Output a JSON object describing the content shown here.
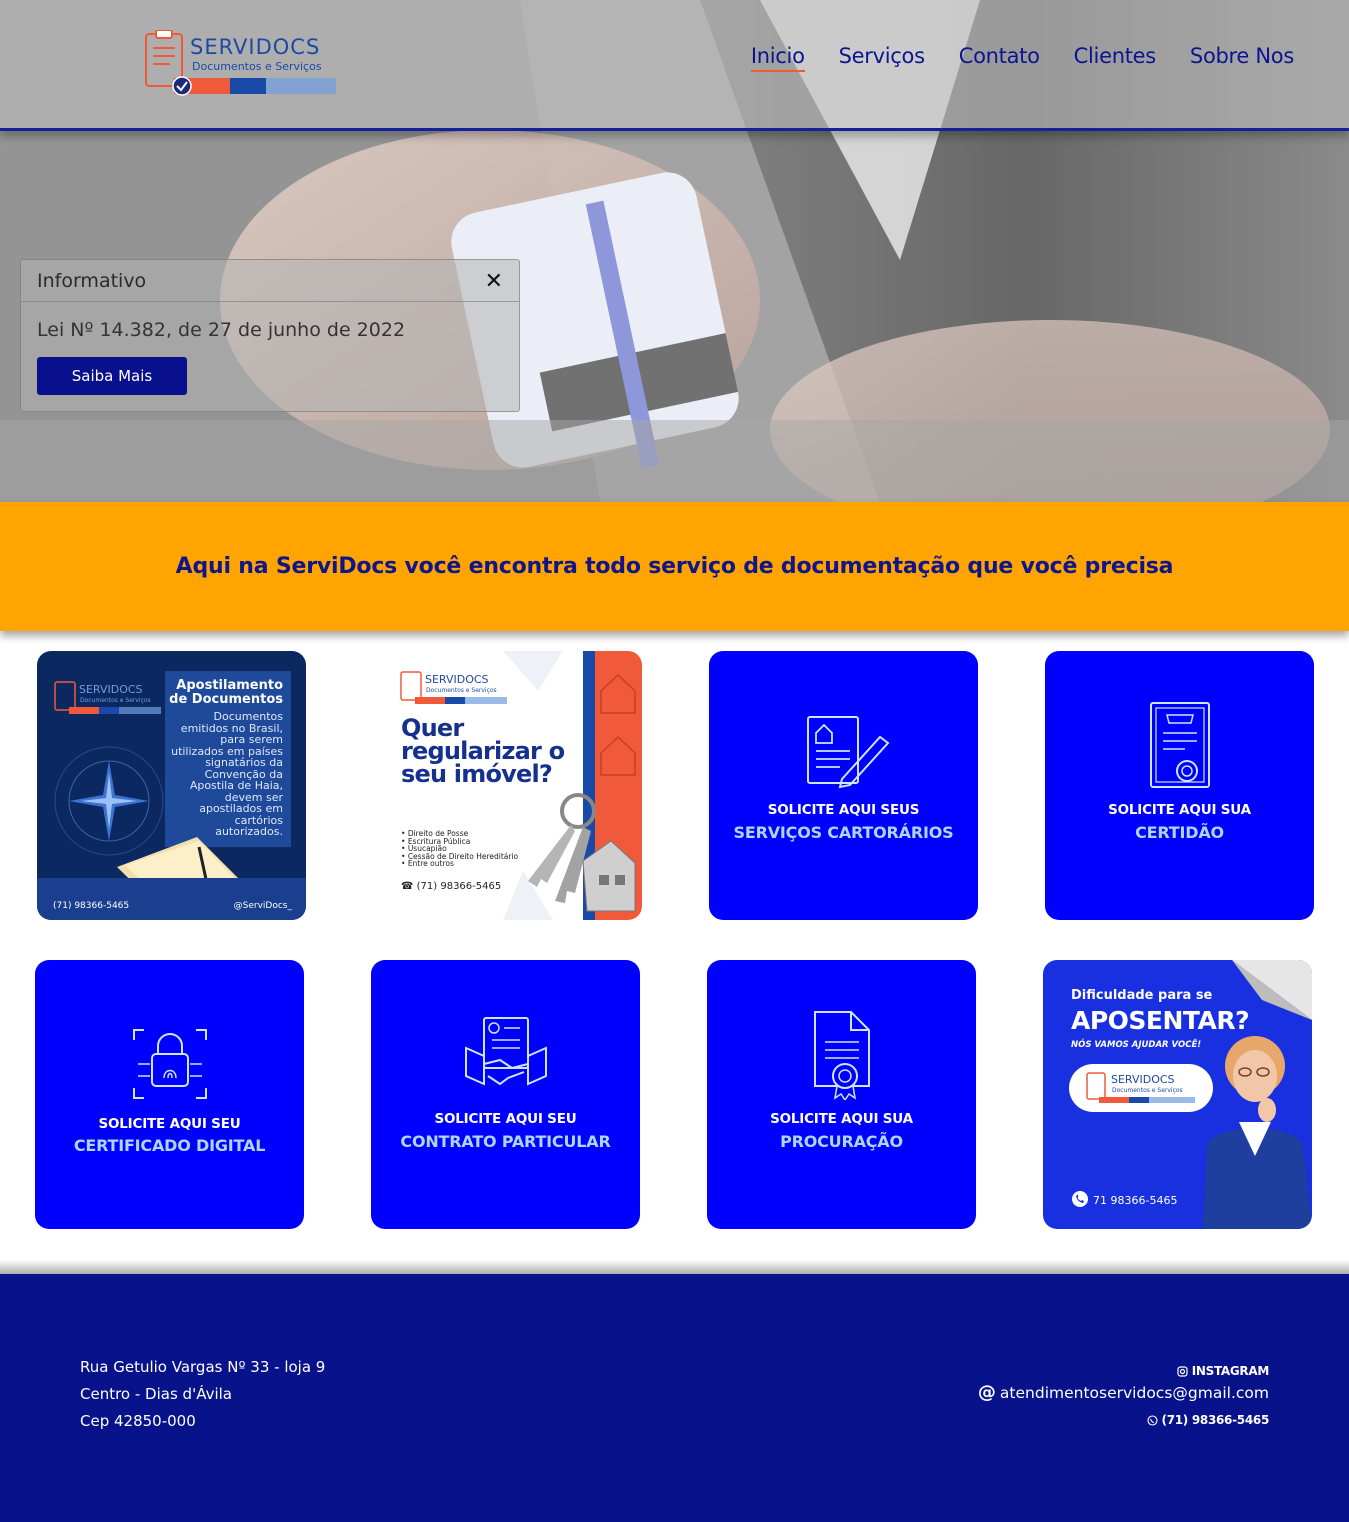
{
  "brand": {
    "name": "SERVIDOCS",
    "tagline": "Documentos e Serviços",
    "colors": {
      "navy": "#08128b",
      "blue": "#0000ff",
      "orange": "#ffa400",
      "coral": "#f05a3a"
    }
  },
  "nav": {
    "items": [
      "Inicio",
      "Serviços",
      "Contato",
      "Clientes",
      "Sobre Nos"
    ],
    "active": "Inicio"
  },
  "info": {
    "title": "Informativo",
    "text": "Lei Nº 14.382, de 27 de junho de 2022",
    "button": "Saiba Mais",
    "close_icon": "close-icon"
  },
  "banner": {
    "text": "Aqui na ServiDocs você encontra todo serviço de documentação que você precisa"
  },
  "cards": {
    "apostilamento": {
      "title_1": "Apostilamento",
      "title_2": "de Documentos",
      "body": "Documentos emitidos no Brasil, para serem utilizados em países signatários da Convenção da Apostila de Haia, devem ser apostilados em cartórios autorizados.",
      "phone": "(71) 98366-5465",
      "instagram": "@ServiDocs_"
    },
    "imovel": {
      "title": "Quer regularizar o seu imóvel?",
      "list": [
        "Direito de Posse",
        "Escritura Pública",
        "Usucapião",
        "Cessão de Direito Hereditário",
        "Entre outros"
      ],
      "phone": "(71) 98366-5465"
    },
    "cartorarios": {
      "line1": "SOLICITE AQUI SEUS",
      "line2": "SERVIÇOS CARTORÁRIOS"
    },
    "certidao": {
      "line1": "SOLICITE AQUI SUA",
      "line2": "CERTIDÃO"
    },
    "certificado": {
      "line1": "SOLICITE AQUI SEU",
      "line2": "CERTIFICADO DIGITAL"
    },
    "contrato": {
      "line1": "SOLICITE AQUI SEU",
      "line2": "CONTRATO PARTICULAR"
    },
    "procuracao": {
      "line1": "SOLICITE AQUI SUA",
      "line2": "PROCURAÇÃO"
    },
    "aposentar": {
      "question": "Dificuldade para se",
      "headline": "APOSENTAR?",
      "sub": "NÓS VAMOS AJUDAR VOCÊ!",
      "phone": "71 98366-5465"
    }
  },
  "footer": {
    "address": [
      "Rua Getulio Vargas Nº 33 - loja 9",
      "Centro - Dias d'Ávila",
      "Cep 42850-000"
    ],
    "instagram": "INSTAGRAM",
    "email": "atendimentoservidocs@gmail.com",
    "whatsapp": "(71) 98366-5465"
  }
}
